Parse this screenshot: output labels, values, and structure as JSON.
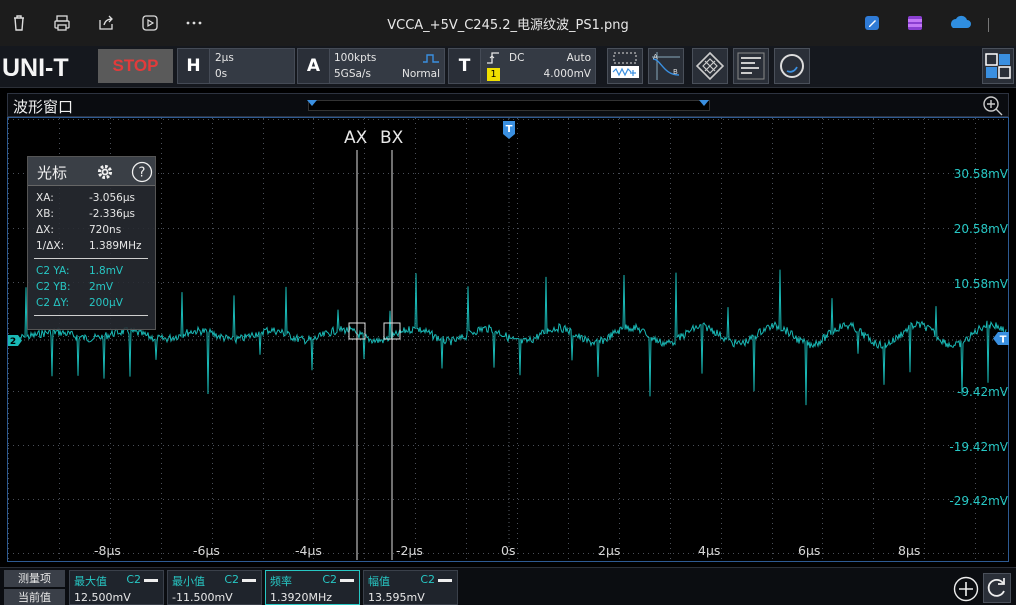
{
  "window": {
    "title": "VCCA_+5V_C245.2_电源纹波_PS1.png"
  },
  "brand": {
    "logo_text": "UNI-T"
  },
  "toolbar": {
    "run_state_label": "STOP",
    "horizontal": {
      "letter": "H",
      "timebase": "2µs",
      "offset": "0s"
    },
    "acquire": {
      "letter": "A",
      "depth": "100kpts",
      "sample_rate": "5GSa/s",
      "mode": "Normal"
    },
    "trigger": {
      "letter": "T",
      "coupling": "DC",
      "sweep": "Auto",
      "source": "1",
      "level": "4.000mV"
    }
  },
  "waveform_window": {
    "title": "波形窗口",
    "trigger_marker": "T",
    "cursor_a_label": "AX",
    "cursor_b_label": "BX",
    "channel_marker": "2",
    "offset_marker_label": "T",
    "y_labels": [
      "30.58mV",
      "20.58mV",
      "10.58mV",
      "-9.42mV",
      "-19.42mV",
      "-29.42mV"
    ],
    "x_labels": [
      "-8µs",
      "-6µs",
      "-4µs",
      "-2µs",
      "0s",
      "2µs",
      "4µs",
      "6µs",
      "8µs"
    ],
    "trace_color": "#19b8b5"
  },
  "cursor_panel": {
    "title": "光标",
    "rows": [
      {
        "key": "XA:",
        "value": "-3.056µs"
      },
      {
        "key": "XB:",
        "value": "-2.336µs"
      },
      {
        "key": "ΔX:",
        "value": "720ns"
      },
      {
        "key": "1/ΔX:",
        "value": "1.389MHz"
      }
    ],
    "channel_rows": [
      {
        "key": "C2 YA:",
        "value": "1.8mV"
      },
      {
        "key": "C2 YB:",
        "value": "2mV"
      },
      {
        "key": "C2 ΔY:",
        "value": "200µV"
      }
    ]
  },
  "measurements": {
    "header_item": "测量项",
    "header_current": "当前值",
    "items": [
      {
        "title": "最大值",
        "channel": "C2",
        "value": "12.500mV"
      },
      {
        "title": "最小值",
        "channel": "C2",
        "value": "-11.500mV"
      },
      {
        "title": "频率",
        "channel": "C2",
        "value": "1.3920MHz"
      },
      {
        "title": "幅值",
        "channel": "C2",
        "value": "13.595mV"
      }
    ]
  },
  "colors": {
    "accent": "#27c7c4",
    "stop": "#e23b3b",
    "frame": "#2d5a92",
    "marker": "#3a8fe0"
  }
}
